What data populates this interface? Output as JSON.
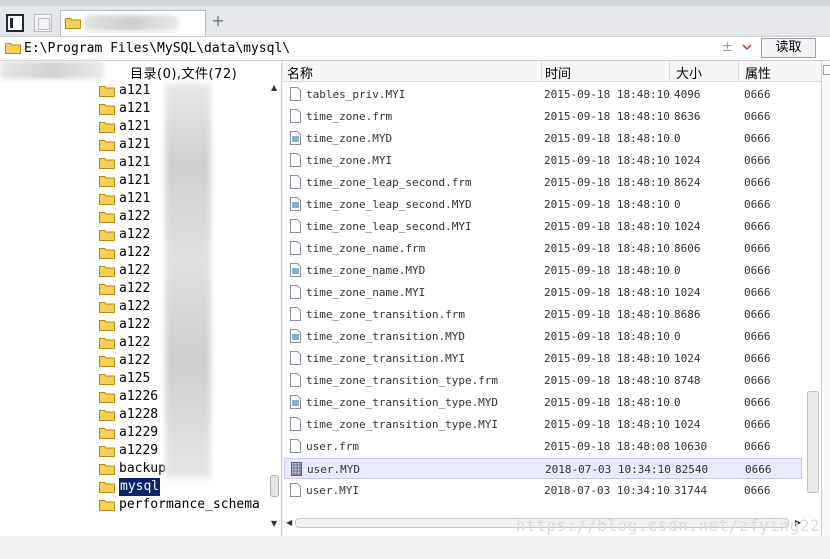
{
  "addressbar": {
    "path": "E:\\Program Files\\MySQL\\data\\mysql\\",
    "plusminus": "±",
    "read_label": "读取"
  },
  "tree": {
    "summary": "目录(0),文件(72)",
    "items": [
      {
        "label": "a121",
        "selected": false
      },
      {
        "label": "a121",
        "selected": false
      },
      {
        "label": "a121",
        "selected": false
      },
      {
        "label": "a121",
        "selected": false
      },
      {
        "label": "a121",
        "selected": false
      },
      {
        "label": "a121",
        "selected": false
      },
      {
        "label": "a121",
        "selected": false
      },
      {
        "label": "a122",
        "selected": false
      },
      {
        "label": "a122",
        "selected": false
      },
      {
        "label": "a122",
        "selected": false
      },
      {
        "label": "a122",
        "selected": false
      },
      {
        "label": "a122",
        "selected": false
      },
      {
        "label": "a122",
        "selected": false
      },
      {
        "label": "a122",
        "selected": false
      },
      {
        "label": "a122",
        "selected": false
      },
      {
        "label": "a122",
        "selected": false
      },
      {
        "label": "a125",
        "selected": false
      },
      {
        "label": "a1226",
        "selected": false
      },
      {
        "label": "a1228",
        "selected": false
      },
      {
        "label": "a1229",
        "selected": false
      },
      {
        "label": "a1229",
        "selected": false
      },
      {
        "label": "backup",
        "selected": false
      },
      {
        "label": "mysql",
        "selected": true
      },
      {
        "label": "performance_schema",
        "selected": false
      }
    ]
  },
  "list": {
    "columns": {
      "name": "名称",
      "time": "时间",
      "size": "大小",
      "attr": "属性"
    },
    "rows": [
      {
        "name": "tables_priv.MYI",
        "time": "2015-09-18 18:48:10",
        "size": "4096",
        "attr": "0666",
        "icon": "file-icon",
        "selected": false
      },
      {
        "name": "time_zone.frm",
        "time": "2015-09-18 18:48:10",
        "size": "8636",
        "attr": "0666",
        "icon": "file-icon",
        "selected": false
      },
      {
        "name": "time_zone.MYD",
        "time": "2015-09-18 18:48:10",
        "size": "0",
        "attr": "0666",
        "icon": "data-file-icon",
        "selected": false
      },
      {
        "name": "time_zone.MYI",
        "time": "2015-09-18 18:48:10",
        "size": "1024",
        "attr": "0666",
        "icon": "file-icon",
        "selected": false
      },
      {
        "name": "time_zone_leap_second.frm",
        "time": "2015-09-18 18:48:10",
        "size": "8624",
        "attr": "0666",
        "icon": "file-icon",
        "selected": false
      },
      {
        "name": "time_zone_leap_second.MYD",
        "time": "2015-09-18 18:48:10",
        "size": "0",
        "attr": "0666",
        "icon": "data-file-icon",
        "selected": false
      },
      {
        "name": "time_zone_leap_second.MYI",
        "time": "2015-09-18 18:48:10",
        "size": "1024",
        "attr": "0666",
        "icon": "file-icon",
        "selected": false
      },
      {
        "name": "time_zone_name.frm",
        "time": "2015-09-18 18:48:10",
        "size": "8606",
        "attr": "0666",
        "icon": "file-icon",
        "selected": false
      },
      {
        "name": "time_zone_name.MYD",
        "time": "2015-09-18 18:48:10",
        "size": "0",
        "attr": "0666",
        "icon": "data-file-icon",
        "selected": false
      },
      {
        "name": "time_zone_name.MYI",
        "time": "2015-09-18 18:48:10",
        "size": "1024",
        "attr": "0666",
        "icon": "file-icon",
        "selected": false
      },
      {
        "name": "time_zone_transition.frm",
        "time": "2015-09-18 18:48:10",
        "size": "8686",
        "attr": "0666",
        "icon": "file-icon",
        "selected": false
      },
      {
        "name": "time_zone_transition.MYD",
        "time": "2015-09-18 18:48:10",
        "size": "0",
        "attr": "0666",
        "icon": "data-file-icon",
        "selected": false
      },
      {
        "name": "time_zone_transition.MYI",
        "time": "2015-09-18 18:48:10",
        "size": "1024",
        "attr": "0666",
        "icon": "file-icon",
        "selected": false
      },
      {
        "name": "time_zone_transition_type.frm",
        "time": "2015-09-18 18:48:10",
        "size": "8748",
        "attr": "0666",
        "icon": "file-icon",
        "selected": false
      },
      {
        "name": "time_zone_transition_type.MYD",
        "time": "2015-09-18 18:48:10",
        "size": "0",
        "attr": "0666",
        "icon": "data-file-icon",
        "selected": false
      },
      {
        "name": "time_zone_transition_type.MYI",
        "time": "2015-09-18 18:48:10",
        "size": "1024",
        "attr": "0666",
        "icon": "file-icon",
        "selected": false
      },
      {
        "name": "user.frm",
        "time": "2015-09-18 18:48:08",
        "size": "10630",
        "attr": "0666",
        "icon": "file-icon",
        "selected": false
      },
      {
        "name": "user.MYD",
        "time": "2018-07-03 10:34:10",
        "size": "82540",
        "attr": "0666",
        "icon": "data-file-icon",
        "selected": true
      },
      {
        "name": "user.MYI",
        "time": "2018-07-03 10:34:10",
        "size": "31744",
        "attr": "0666",
        "icon": "file-icon",
        "selected": false
      }
    ]
  },
  "watermark": "https://blog.csdn.net/zfying22"
}
